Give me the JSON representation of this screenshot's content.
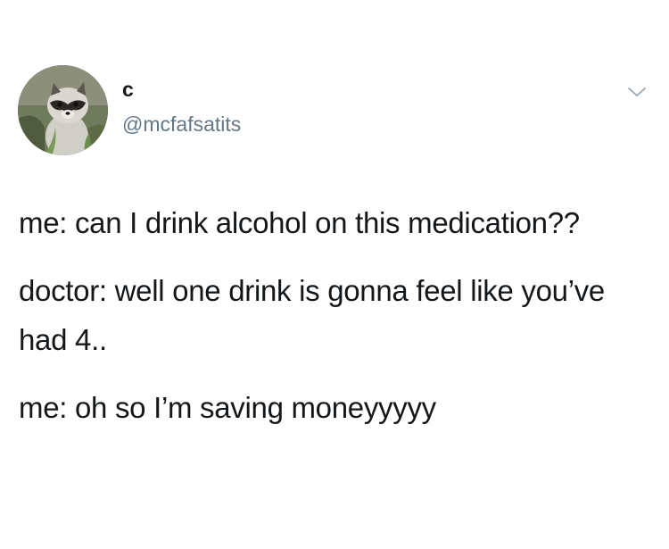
{
  "author": {
    "display_name": "c",
    "handle": "@mcfafsatits",
    "avatar_icon": "raccoon-avatar"
  },
  "menu": {
    "icon": "chevron-down-icon"
  },
  "tweet": {
    "lines": [
      "me: can I drink alcohol on this medication??",
      "doctor: well one drink is gonna feel like you’ve had 4..",
      "me: oh so I’m saving moneyyyyy"
    ]
  },
  "colors": {
    "text": "#14171a",
    "secondary_text": "#657786",
    "chevron": "#9aa5b1",
    "background": "#ffffff"
  }
}
